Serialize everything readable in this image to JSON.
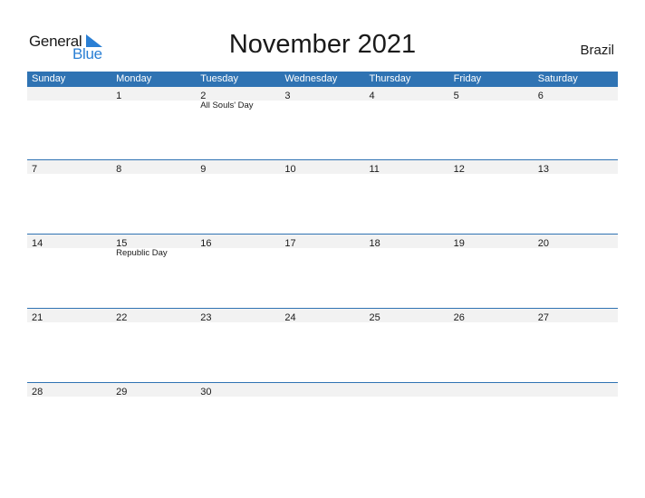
{
  "logo": {
    "word1": "General",
    "word2": "Blue"
  },
  "title": "November 2021",
  "country": "Brazil",
  "colors": {
    "header_bg": "#2f73b3",
    "number_bar_bg": "#f2f2f2",
    "logo_blue": "#2a7fd4"
  },
  "weekdays": [
    "Sunday",
    "Monday",
    "Tuesday",
    "Wednesday",
    "Thursday",
    "Friday",
    "Saturday"
  ],
  "weeks": [
    [
      {
        "day": ""
      },
      {
        "day": "1"
      },
      {
        "day": "2",
        "holiday": "All Souls' Day"
      },
      {
        "day": "3"
      },
      {
        "day": "4"
      },
      {
        "day": "5"
      },
      {
        "day": "6"
      }
    ],
    [
      {
        "day": "7"
      },
      {
        "day": "8"
      },
      {
        "day": "9"
      },
      {
        "day": "10"
      },
      {
        "day": "11"
      },
      {
        "day": "12"
      },
      {
        "day": "13"
      }
    ],
    [
      {
        "day": "14"
      },
      {
        "day": "15",
        "holiday": "Republic Day"
      },
      {
        "day": "16"
      },
      {
        "day": "17"
      },
      {
        "day": "18"
      },
      {
        "day": "19"
      },
      {
        "day": "20"
      }
    ],
    [
      {
        "day": "21"
      },
      {
        "day": "22"
      },
      {
        "day": "23"
      },
      {
        "day": "24"
      },
      {
        "day": "25"
      },
      {
        "day": "26"
      },
      {
        "day": "27"
      }
    ],
    [
      {
        "day": "28"
      },
      {
        "day": "29"
      },
      {
        "day": "30"
      },
      {
        "day": ""
      },
      {
        "day": ""
      },
      {
        "day": ""
      },
      {
        "day": ""
      }
    ]
  ]
}
